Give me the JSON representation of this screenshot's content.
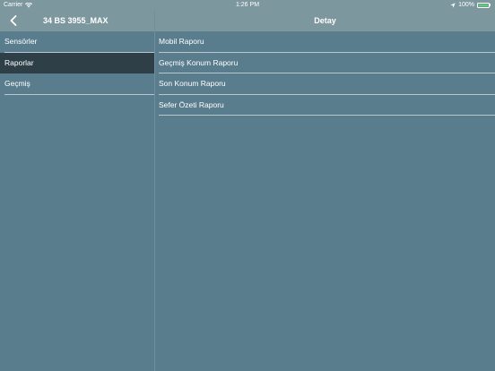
{
  "status_bar": {
    "carrier": "Carrier",
    "time": "1:26 PM",
    "battery": "100%"
  },
  "nav": {
    "back_icon": "chevron-left-icon",
    "master_title": "34 BS 3955_MAX",
    "detail_title": "Detay"
  },
  "master": {
    "items": [
      {
        "label": "Sensörler",
        "selected": false
      },
      {
        "label": "Raporlar",
        "selected": true
      },
      {
        "label": "Geçmiş",
        "selected": false
      }
    ]
  },
  "detail": {
    "items": [
      {
        "label": "Mobil Raporu"
      },
      {
        "label": "Geçmiş Konum Raporu"
      },
      {
        "label": "Son Konum Raporu"
      },
      {
        "label": "Sefer Özeti Raporu"
      }
    ]
  },
  "colors": {
    "background": "#5a7d8e",
    "bar": "#7d979f",
    "selected": "#2e3f48",
    "battery": "#4cd964"
  }
}
